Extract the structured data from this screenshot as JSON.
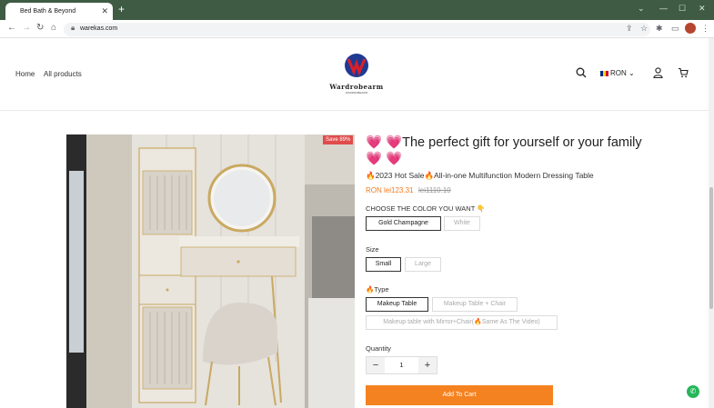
{
  "browser": {
    "tab_title": "Bed Bath & Beyond",
    "tab_close": "✕",
    "new_tab": "+",
    "url": "warekas.com"
  },
  "header": {
    "nav": [
      "Home",
      "All products"
    ],
    "logo_name": "Wardrobearm",
    "logo_sub": "WARDROBEARM",
    "currency": "RON"
  },
  "product": {
    "save_badge": "Save 89%",
    "title": "💗 💗The perfect gift for yourself or your family💗 💗",
    "subtitle": "🔥2023 Hot Sale🔥All-in-one Multifunction Modern Dressing Table",
    "price": "RON lei123.31",
    "compare_price": "lei1110.10",
    "color_label": "CHOOSE THE COLOR YOU WANT 👇",
    "colors": [
      "Gold Champagne",
      "White"
    ],
    "size_label": "Size",
    "sizes": [
      "Small",
      "Large"
    ],
    "type_label": "🔥Type",
    "types": [
      "Makeup Table",
      "Makeup Table + Chair",
      "Makeup table with Mirror+Chair(🔥Same As The Video)"
    ],
    "quantity_label": "Quantity",
    "quantity": "1",
    "minus": "−",
    "plus": "+",
    "add_to_cart": "Add To Cart"
  },
  "colors": {
    "accent": "#f58220",
    "price": "#f07b22",
    "tabstrip": "#3f5b44",
    "badge": "#e04c4c"
  }
}
